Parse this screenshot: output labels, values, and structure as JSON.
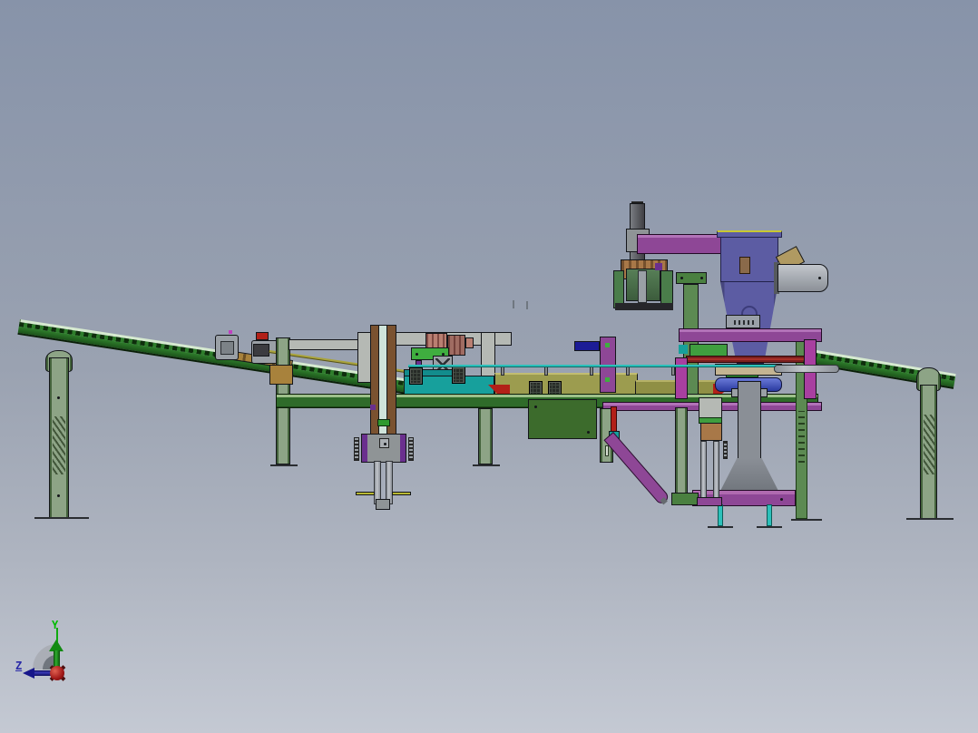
{
  "view": {
    "type": "cad-3d-viewport-side-elevation",
    "axis_triad": {
      "y_label": "Y",
      "z_label": "Z"
    }
  },
  "colors": {
    "bg_top": "#8793a9",
    "bg_mid": "#9aa2b1",
    "bg_bot": "#c4c9d3",
    "outline": "#14161a",
    "conv_green": "#2e7d2b",
    "conv_teeth": "#0e2e0c",
    "conv_rail": "#d6ead0",
    "conv_dark": "#1c521a",
    "sage": "#8da486",
    "sage_dark": "#44633c",
    "grass_light": "#9dc08a",
    "frame_green": "#2f6b2a",
    "box_green": "#3c6b2c",
    "bright_green": "#3fae3f",
    "mid_green": "#5c8a52",
    "plate_green": "#4a8040",
    "olive": "#9c9c4f",
    "olive_dark": "#8f8f45",
    "olive_light": "#c2bd70",
    "teal": "#17a09c",
    "teal_bright": "#2cc0ba",
    "navy": "#1c1c96",
    "purple": "#8e4796",
    "magenta": "#a83fa0",
    "violet": "#6a2f8e",
    "indigo": "#5c5ca3",
    "salmon": "#b97f72",
    "red": "#b22018",
    "dark_red": "#7a1f1f",
    "brown": "#7a5230",
    "tan": "#a8823c",
    "tan_light": "#c4b492",
    "tan_block": "#a87848",
    "gray_light": "#b5b9b4",
    "gray_mid": "#9aa0a6",
    "gray_dark": "#55595c",
    "steel_hi": "#c2c6cc",
    "steel_lo": "#8b9097",
    "yellow": "#b8b832",
    "yellow_hi": "#c8c832",
    "axis_green": "#00bb00",
    "axis_blue": "#2a2aa8",
    "sphere_red": "#b01818"
  }
}
